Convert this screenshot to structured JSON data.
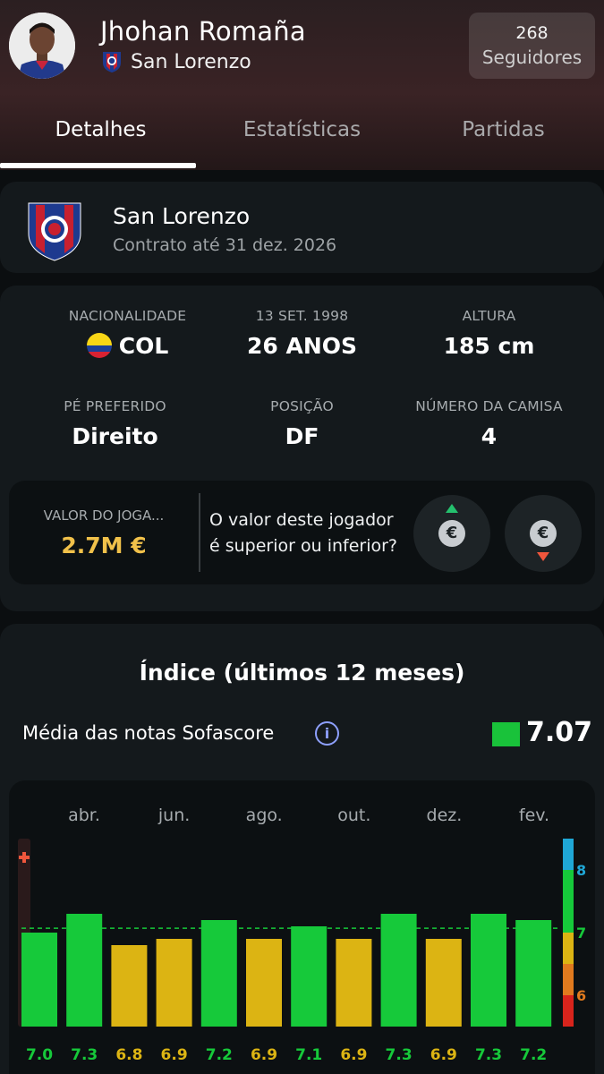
{
  "header": {
    "player_name": "Jhohan Romaña",
    "club": "San Lorenzo",
    "followers_count": "268",
    "followers_label": "Seguidores"
  },
  "tabs": [
    {
      "label": "Detalhes",
      "active": true
    },
    {
      "label": "Estatísticas",
      "active": false
    },
    {
      "label": "Partidas",
      "active": false
    }
  ],
  "club_card": {
    "name": "San Lorenzo",
    "contract": "Contrato até 31 dez. 2026"
  },
  "info": {
    "nationality": {
      "label": "NACIONALIDADE",
      "value": "COL"
    },
    "birth": {
      "label": "13 SET. 1998",
      "value": "26 ANOS"
    },
    "height": {
      "label": "ALTURA",
      "value": "185 cm"
    },
    "foot": {
      "label": "PÉ PREFERIDO",
      "value": "Direito"
    },
    "position": {
      "label": "POSIÇÃO",
      "value": "DF"
    },
    "shirt": {
      "label": "NÚMERO DA CAMISA",
      "value": "4"
    }
  },
  "market_value": {
    "label": "VALOR DO JOGA...",
    "value": "2.7M €",
    "question_line1": "O valor deste jogador",
    "question_line2": "é superior ou inferior?",
    "coin_symbol": "€"
  },
  "rating": {
    "title": "Índice (últimos 12 meses)",
    "average_label": "Média das notas Sofascore",
    "info_symbol": "i",
    "average_value": "7.07",
    "average_color": "#19c23a"
  },
  "chart_data": {
    "type": "bar",
    "month_ticks": [
      "abr.",
      "jun.",
      "ago.",
      "out.",
      "dez.",
      "fev."
    ],
    "values": [
      7.0,
      7.3,
      6.8,
      6.9,
      7.2,
      6.9,
      7.1,
      6.9,
      7.3,
      6.9,
      7.3,
      7.2
    ],
    "value_labels": [
      "7.0",
      "7.3",
      "6.8",
      "6.9",
      "7.2",
      "6.9",
      "7.1",
      "6.9",
      "7.3",
      "6.9",
      "7.3",
      "7.2"
    ],
    "reference_line": 7.07,
    "ylim": [
      5.5,
      8.5
    ],
    "scale_labels": [
      "8",
      "7",
      "6"
    ],
    "colors": {
      "green": "#16c93a",
      "yellow": "#dcb413",
      "orange": "#e07a1e",
      "red": "#d8241c",
      "blue": "#1fa7d6"
    }
  }
}
